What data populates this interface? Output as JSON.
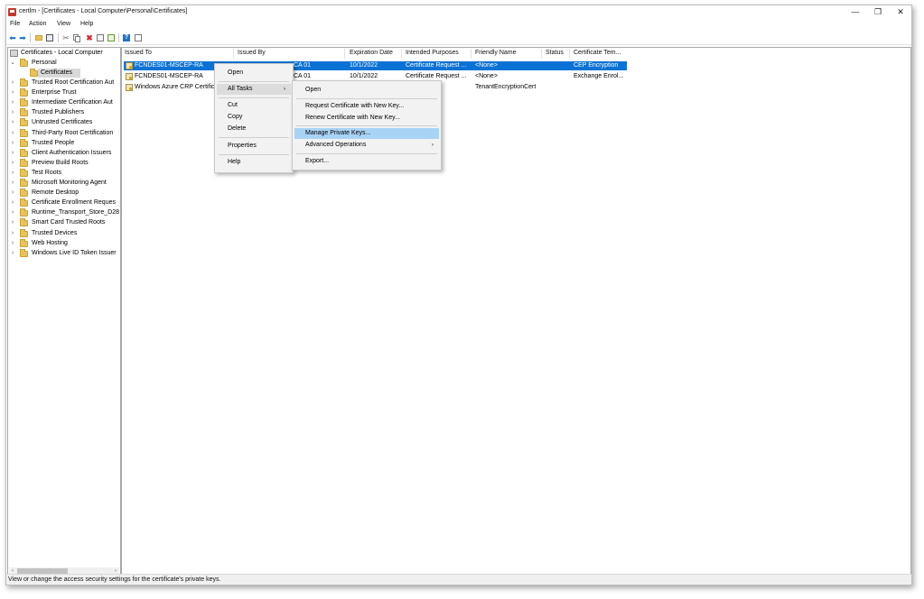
{
  "window": {
    "title": "certlm - [Certificates - Local Computer\\Personal\\Certificates]",
    "minimize_glyph": "—",
    "restore_glyph": "❐",
    "close_glyph": "✕"
  },
  "menubar": {
    "file": "File",
    "action": "Action",
    "view": "View",
    "help": "Help"
  },
  "toolbar": {
    "icons": [
      "back-arrow-icon",
      "forward-arrow-icon",
      "up-folder-icon",
      "show-hide-tree-icon",
      "cut-icon",
      "copy-icon",
      "delete-icon",
      "properties-icon",
      "export-icon",
      "help-icon",
      "details-icon"
    ],
    "colors": {
      "back": "#1e73c8",
      "delete": "#d32f2f",
      "help": "#1e73c8"
    }
  },
  "tree": {
    "root": "Certificates - Local Computer",
    "personal": "Personal",
    "certificates": "Certificates",
    "stores": [
      "Trusted Root Certification Aut",
      "Enterprise Trust",
      "Intermediate Certification Aut",
      "Trusted Publishers",
      "Untrusted Certificates",
      "Third-Party Root Certification",
      "Trusted People",
      "Client Authentication Issuers",
      "Preview Build Roots",
      "Test Roots",
      "Microsoft Monitoring Agent",
      "Remote Desktop",
      "Certificate Enrollment Reques",
      "Runtime_Transport_Store_D28",
      "Smart Card Trusted Roots",
      "Trusted Devices",
      "Web Hosting",
      "Windows Live ID Token Issuer"
    ]
  },
  "list": {
    "columns": [
      "Issued To",
      "Issued By",
      "Expiration Date",
      "Intended Purposes",
      "Friendly Name",
      "Status",
      "Certificate Tem..."
    ],
    "rows": [
      {
        "issued_to": "FCNDES01-MSCEP-RA",
        "issued_by": "CA 01",
        "expiration": "10/1/2022",
        "purposes": "Certificate Request ...",
        "friendly": "<None>",
        "status": "",
        "template": "CEP Encryption"
      },
      {
        "issued_to": "FCNDES01-MSCEP-RA",
        "issued_by": "CA 01",
        "expiration": "10/1/2022",
        "purposes": "Certificate Request ...",
        "friendly": "<None>",
        "status": "",
        "template": "Exchange Enrol..."
      },
      {
        "issued_to": "Windows Azure CRP Certifica",
        "issued_by": "",
        "expiration": "",
        "purposes": "",
        "friendly": "TenantEncryptionCert",
        "status": "",
        "template": ""
      }
    ],
    "selected_color": "#0a72d4"
  },
  "context_menu": {
    "open": "Open",
    "all_tasks": "All Tasks",
    "cut": "Cut",
    "copy": "Copy",
    "delete": "Delete",
    "properties": "Properties",
    "help": "Help",
    "submenu_arrow": "›"
  },
  "submenu": {
    "open": "Open",
    "request_new_key": "Request Certificate with New Key...",
    "renew_new_key": "Renew Certificate with New Key...",
    "manage_keys": "Manage Private Keys...",
    "advanced": "Advanced Operations",
    "export": "Export...",
    "submenu_arrow": "›"
  },
  "statusbar": {
    "text": "View or change the access security settings for the certificate's private keys."
  }
}
